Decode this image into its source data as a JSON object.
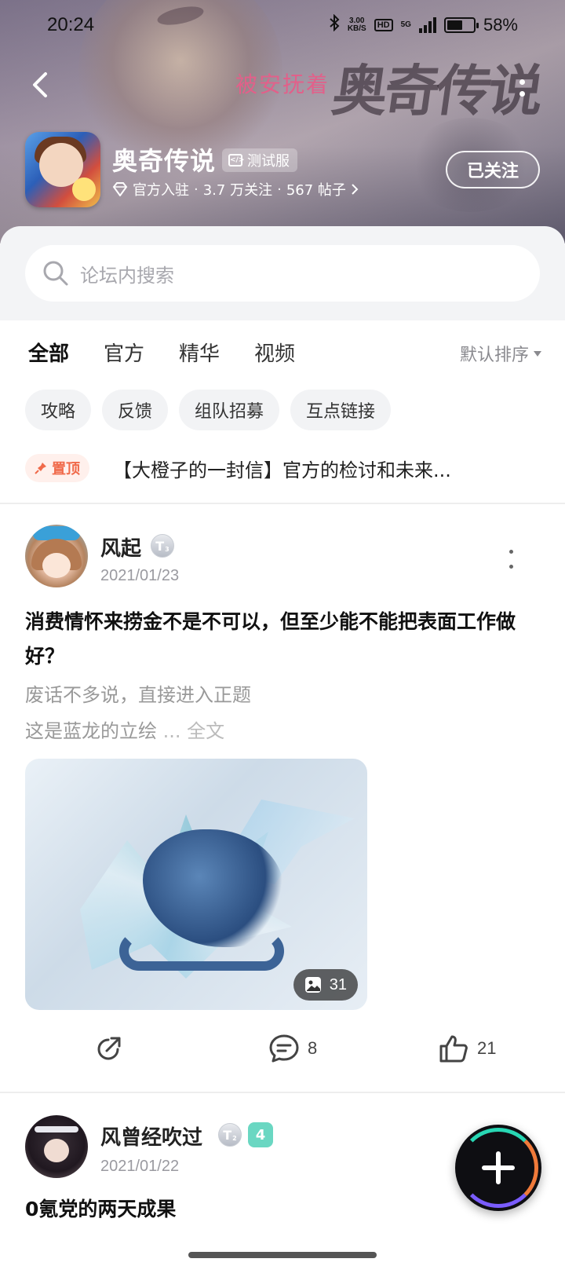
{
  "status_bar": {
    "time": "20:24",
    "net_speed_value": "3.00",
    "net_speed_unit": "KB/S",
    "hd": "HD",
    "network": "5G",
    "battery": "58%",
    "battery_level": 0.58
  },
  "header": {
    "watermark": "被安抚着",
    "game_logo": "奥奇传说",
    "game_name": "奥奇传说",
    "test_badge": "测试服",
    "meta": {
      "official": "官方入驻",
      "followers": "3.7 万关注",
      "posts": "567 帖子"
    },
    "follow_button": "已关注"
  },
  "search": {
    "placeholder": "论坛内搜索"
  },
  "tabs": [
    {
      "label": "全部",
      "active": true
    },
    {
      "label": "官方",
      "active": false
    },
    {
      "label": "精华",
      "active": false
    },
    {
      "label": "视频",
      "active": false
    }
  ],
  "sort_label": "默认排序",
  "chips": [
    "攻略",
    "反馈",
    "组队招募",
    "互点链接"
  ],
  "pinned": {
    "badge": "置顶",
    "title": "【大橙子的一封信】官方的检讨和未来..."
  },
  "posts": [
    {
      "author": "风起",
      "level": "T",
      "level_num": "3",
      "date": "2021/01/23",
      "title": "消费情怀来捞金不是不可以，但至少能不能把表面工作做好？",
      "body_line1": "废话不多说，直接进入正题",
      "body_line2": "这是蓝龙的立绘",
      "ellipsis": " ... ",
      "full_text": "全文",
      "image_count": "31",
      "comments": "8",
      "likes": "21"
    },
    {
      "author": "风曾经吹过",
      "level": "T",
      "level_num": "2",
      "badge": "4",
      "date": "2021/01/22",
      "title": "0氪党的两天成果"
    }
  ],
  "colors": {
    "accent": "#21d0b2",
    "pin": "#f06a4a",
    "watermark": "#e2608a"
  }
}
